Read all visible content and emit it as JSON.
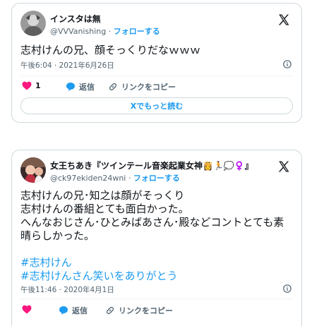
{
  "colors": {
    "accent": "#1d9bf0",
    "like": "#f91880",
    "border": "#cfd9de",
    "secondary": "#536471"
  },
  "tweet1": {
    "name": "インスタは無",
    "handle": "@VVVanishing",
    "separator": " · ",
    "follow": "フォローする",
    "text": "志村けんの兄、顔そっくりだなｗｗｗ",
    "timestamp": "午後6:04 · 2021年6月26日",
    "like_count": "1",
    "reply_label": "返信",
    "copy_label": "リンクをコピー",
    "read_more": "Xでもっと読む"
  },
  "tweet2": {
    "name": "女王ちあき『ツインテール音楽起業女神👸🏃💭♀️』",
    "handle": "@ck97ekiden24wni",
    "separator": " · ",
    "follow": "フォローする",
    "lines": [
      "志村けんの兄･知之は顔がそっくり",
      "志村けんの番組とても面白かった。",
      "へんなおじさん･ひとみばあさん･殿などコントとても素",
      "晴らしかった。"
    ],
    "hashtags": [
      "#志村けん",
      "#志村けんさん笑いをありがとう"
    ],
    "timestamp": "午後11:46 · 2020年4月1日",
    "reply_label": "返信",
    "copy_label": "リンクをコピー"
  }
}
